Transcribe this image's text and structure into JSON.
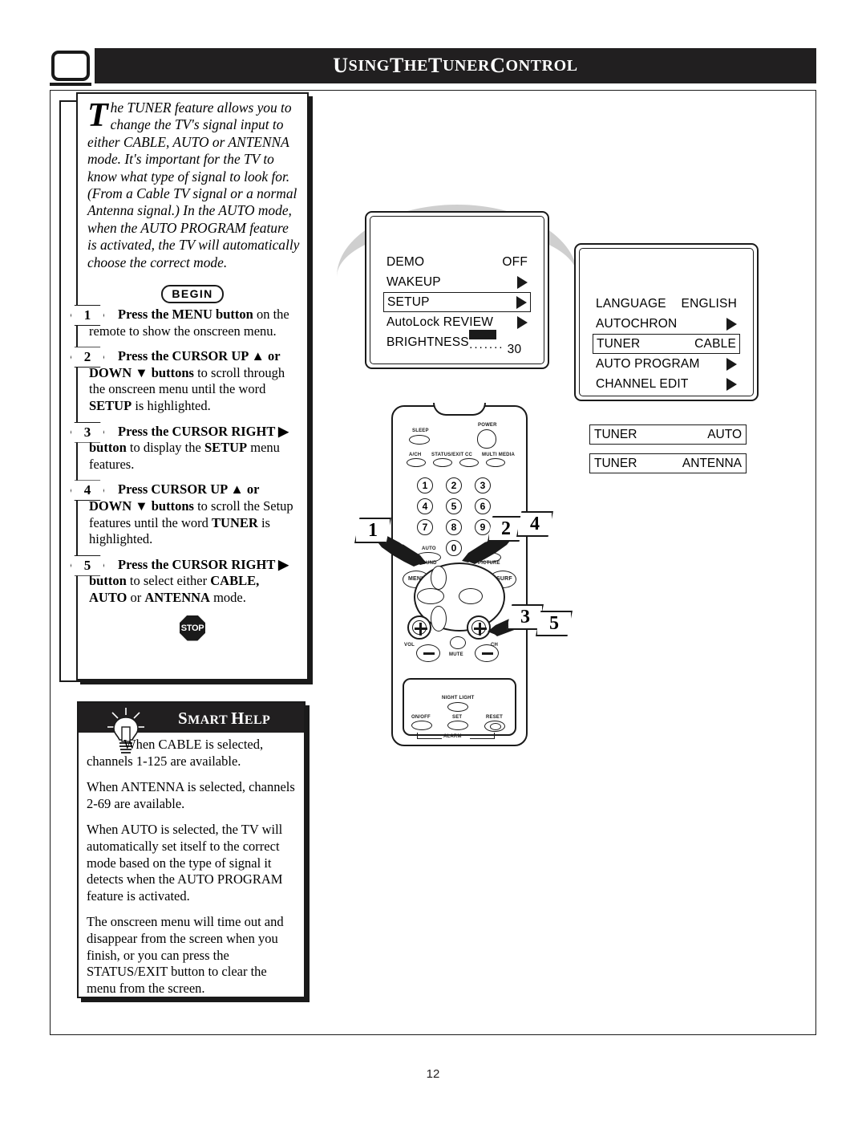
{
  "header": {
    "title_parts": [
      {
        "t": "U",
        "big": true
      },
      {
        "t": "SING",
        "big": false
      },
      {
        "t": " ",
        "big": false
      },
      {
        "t": "T",
        "big": true
      },
      {
        "t": "HE",
        "big": false
      },
      {
        "t": " ",
        "big": false
      },
      {
        "t": "T",
        "big": true
      },
      {
        "t": "UNER",
        "big": false
      },
      {
        "t": " ",
        "big": false
      },
      {
        "t": "C",
        "big": true
      },
      {
        "t": "ONTROL",
        "big": false
      }
    ],
    "title_plain": "USING THE TUNER CONTROL",
    "tv_icon": "tv-screen-icon"
  },
  "intro": {
    "dropcap": "T",
    "text": "he TUNER feature allows you to change the TV's signal input to either CABLE, AUTO or ANTENNA mode. It's important for the TV to know what type of signal to look for. (From a Cable TV signal or a normal Antenna signal.) In the AUTO mode, when the AUTO PROGRAM feature is activated, the TV will automatically choose the correct mode.",
    "begin_badge": "BEGIN"
  },
  "steps": [
    {
      "num": "1",
      "html": "<span class=\"b\">Press the MENU button</span> on the remote to show the onscreen menu."
    },
    {
      "num": "2",
      "html": "<span class=\"b\">Press the CURSOR UP &#9650; or DOWN &#9660; buttons</span> to scroll through the onscreen menu until the word <span class=\"b\">SETUP</span> is highlighted."
    },
    {
      "num": "3",
      "html": "<span class=\"b\">Press the CURSOR RIGHT &#9654; button</span> to display the <span class=\"b\">SETUP</span> menu features."
    },
    {
      "num": "4",
      "html": "<span class=\"b\">Press CURSOR UP &#9650; or DOWN &#9660; buttons</span> to scroll the Setup features until the word <span class=\"b\">TUNER</span> is highlighted."
    },
    {
      "num": "5",
      "html": "<span class=\"b\">Press the CURSOR RIGHT &#9654; button</span> to select either <span class=\"b\">CABLE, AUTO</span> or <span class=\"b\">ANTENNA</span> mode."
    }
  ],
  "stop_badge": "STOP",
  "smart_help": {
    "title_parts": [
      {
        "t": "S",
        "big": true
      },
      {
        "t": "MART",
        "big": false
      },
      {
        "t": " ",
        "big": false
      },
      {
        "t": "H",
        "big": true
      },
      {
        "t": "ELP",
        "big": false
      }
    ],
    "title_plain": "SMART HELP",
    "bulb_icon": "lightbulb-icon",
    "paragraphs": [
      "When CABLE is selected, channels 1-125 are available.",
      "When ANTENNA is selected, channels 2-69 are available.",
      "When AUTO is selected, the TV will automatically set itself to the correct mode based on the type of signal it detects when the AUTO PROGRAM feature is activated.",
      "The onscreen menu will time out and disappear from the screen when you finish, or you can press the STATUS/EXIT button to clear the menu from the screen."
    ]
  },
  "osd_main": {
    "rows": [
      {
        "label": "DEMO",
        "value": "OFF",
        "type": "text",
        "highlight": false
      },
      {
        "label": "WAKEUP",
        "value": "",
        "type": "arrow",
        "highlight": false
      },
      {
        "label": "SETUP",
        "value": "",
        "type": "arrow",
        "highlight": true
      },
      {
        "label": "AutoLock REVIEW",
        "value": "",
        "type": "arrow",
        "highlight": false
      },
      {
        "label": "BRIGHTNESS",
        "value": "30",
        "type": "bar",
        "highlight": false
      }
    ]
  },
  "osd_setup": {
    "rows": [
      {
        "label": "LANGUAGE",
        "value": "ENGLISH",
        "type": "text",
        "highlight": false
      },
      {
        "label": "AUTOCHRON",
        "value": "",
        "type": "arrow",
        "highlight": false
      },
      {
        "label": "TUNER",
        "value": "CABLE",
        "type": "text",
        "highlight": true
      },
      {
        "label": "AUTO PROGRAM",
        "value": "",
        "type": "arrow",
        "highlight": false
      },
      {
        "label": "CHANNEL EDIT",
        "value": "",
        "type": "arrow",
        "highlight": false
      }
    ]
  },
  "tuner_variants": [
    {
      "label": "TUNER",
      "value": "AUTO"
    },
    {
      "label": "TUNER",
      "value": "ANTENNA"
    }
  ],
  "remote": {
    "top_labels": [
      {
        "name": "SLEEP"
      },
      {
        "name": "POWER"
      },
      {
        "name": "A/CH"
      },
      {
        "name": "STATUS/EXIT"
      },
      {
        "name": "CC"
      },
      {
        "name": "MULTI MEDIA"
      }
    ],
    "keypad": [
      "1",
      "2",
      "3",
      "4",
      "5",
      "6",
      "7",
      "8",
      "9",
      "0"
    ],
    "mid_labels": [
      {
        "name": "AUTO"
      },
      {
        "name": "SOUND"
      },
      {
        "name": "AUTO"
      },
      {
        "name": "PICTURE"
      },
      {
        "name": "MENU"
      },
      {
        "name": "SURF"
      }
    ],
    "cursor_labels": [
      {
        "name": "VOL"
      },
      {
        "name": "CH"
      },
      {
        "name": "MUTE"
      }
    ],
    "bottom_labels": [
      {
        "name": "NIGHT LIGHT"
      },
      {
        "name": "ON/OFF"
      },
      {
        "name": "SET"
      },
      {
        "name": "RESET"
      },
      {
        "name": "ALARM"
      }
    ]
  },
  "callouts": [
    {
      "num": "1"
    },
    {
      "num": "2"
    },
    {
      "num": "4"
    },
    {
      "num": "3"
    },
    {
      "num": "5"
    }
  ],
  "footer": {
    "page_number": "12"
  },
  "colors": {
    "ink": "#1a1a1a",
    "header_bar": "#211f20",
    "grey_connector": "#cfcfcf",
    "paper": "#ffffff"
  }
}
